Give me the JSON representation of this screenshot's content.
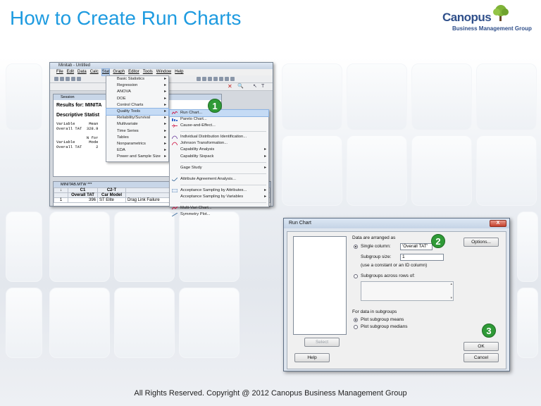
{
  "slide": {
    "title": "How to Create Run Charts",
    "copyright": "All Rights Reserved. Copyright @ 2012 Canopus Business Management Group"
  },
  "logo": {
    "name": "Canopus",
    "tagline": "Business Management Group"
  },
  "minitab": {
    "window_title": "Minitab - Untitled",
    "menubar": [
      "File",
      "Edit",
      "Data",
      "Calc",
      "Stat",
      "Graph",
      "Editor",
      "Tools",
      "Window",
      "Help"
    ],
    "session": {
      "title": "Session",
      "results_label": "Results for: MINITA",
      "desc_label": "Descriptive Statist",
      "text_lines": [
        "Variable      Mean",
        "Overall TAT  328.9",
        "",
        "             N for",
        "Variable      Mode",
        "Overall TAT      2"
      ]
    },
    "worksheet": {
      "title": "MINITAB.MTW ***",
      "col_ids": [
        "↓",
        "C1",
        "C2-T",
        ""
      ],
      "col_names": [
        "",
        "Overall TAT",
        "Car Model",
        "Replaceme"
      ],
      "row": [
        "1",
        "396",
        "ST Elite",
        "Drag Link Failure"
      ]
    }
  },
  "stat_menu": {
    "items": [
      "Basic Statistics",
      "Regression",
      "ANOVA",
      "DOE",
      "Control Charts",
      "Quality Tools",
      "Reliability/Survival",
      "Multivariate",
      "Time Series",
      "Tables",
      "Nonparametrics",
      "EDA",
      "Power and Sample Size"
    ],
    "selected": "Quality Tools"
  },
  "quality_menu": {
    "items": [
      "Run Chart...",
      "Pareto Chart...",
      "Cause-and-Effect...",
      "Individual Distribution Identification...",
      "Johnson Transformation...",
      "Capability Analysis",
      "Capability Sixpack",
      "Gage Study",
      "Attribute Agreement Analysis...",
      "Acceptance Sampling by Attributes...",
      "Acceptance Sampling by Variables",
      "Multi-Vari Chart...",
      "Symmetry Plot..."
    ],
    "selected": "Run Chart..."
  },
  "dialog": {
    "title": "Run Chart",
    "close": "X",
    "arranged_label": "Data are arranged as",
    "single_column_label": "Single column:",
    "single_column_value": "'Overall TAT'",
    "subgroup_size_label": "Subgroup size:",
    "subgroup_size_value": "1",
    "subgroup_hint": "(use a constant or an ID column)",
    "across_rows_label": "Subgroups across rows of:",
    "subgroups_label": "For data in subgroups",
    "plot_means": "Plot subgroup means",
    "plot_medians": "Plot subgroup medians",
    "options_button": "Options...",
    "select_button": "Select",
    "help_button": "Help",
    "ok_button": "OK",
    "cancel_button": "Cancel"
  },
  "callouts": [
    "1",
    "2",
    "3"
  ],
  "colors": {
    "title": "#1e9be0",
    "callout": "#2f9a37",
    "highlight": "#c5dbf5"
  }
}
